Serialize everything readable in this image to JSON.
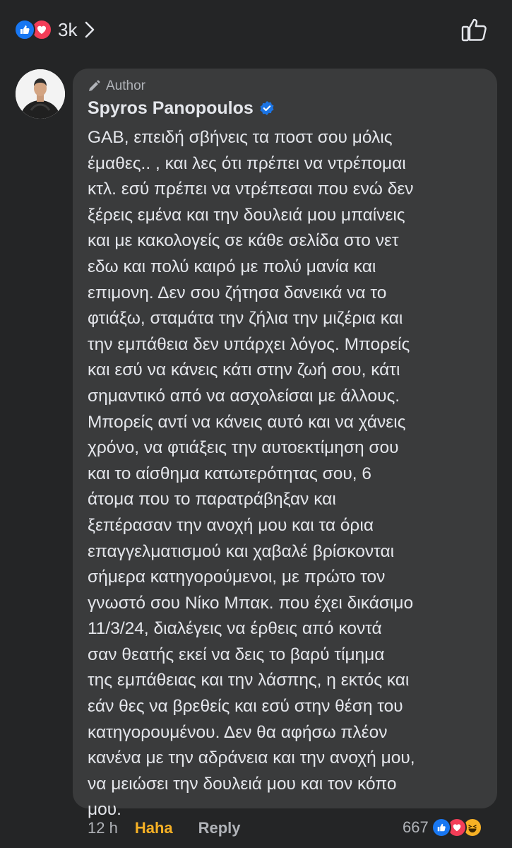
{
  "reactions_bar": {
    "count": "3k",
    "icons": [
      "like-icon",
      "love-icon"
    ],
    "colors": {
      "like": "#1877f2",
      "love": "#f33e58",
      "haha": "#f7b125"
    }
  },
  "comment": {
    "author_label": "Author",
    "name": "Spyros Panopoulos",
    "verified": true,
    "text": "GAB, επειδή σβήνεις τα ποστ σου μόλις\nέμαθες.. , και λες ότι πρέπει να ντρέπομαι\nκτλ. εσύ πρέπει να ντρέπεσαι που ενώ δεν\nξέρεις εμένα και την δουλειά μου μπαίνεις\nκαι με κακολογείς σε κάθε σελίδα στο νετ\nεδω και πολύ καιρό με πολύ μανία και\nεπιμονη. Δεν σου ζήτησα δανεικά να το\nφτιάξω, σταμάτα την ζήλια την μιζέρια και\nτην εμπάθεια δεν υπάρχει λόγος. Μπορείς\nκαι εσύ να κάνεις κάτι στην ζωή σου, κάτι\nσημαντικό από να ασχολείσαι με άλλους.\nΜπορείς αντί να κάνεις αυτό και να χάνεις\nχρόνο, να φτιάξεις την αυτοεκτίμηση σου\nκαι το αίσθημα κατωτερότητας σου, 6\nάτομα που το παρατράβηξαν και\nξεπέρασαν την ανοχή μου και τα όρια\nεπαγγελματισμού και χαβαλέ βρίσκονται\nσήμερα κατηγορούμενοι, με πρώτο τον\nγνωστό σου Νίκο Μπακ. που έχει δικάσιμο\n11/3/24, διαλέγεις να έρθεις από κοντά\nσαν θεατής εκεί να δεις το βαρύ τίμημα\nτης εμπάθειας και την λάσπης, η εκτός και\nεάν θες να βρεθείς και εσύ στην θέση του\nκατηγορουμένου. Δεν θα αφήσω πλέον\nκανένα με την αδράνεια και την ανοχή μου,\nνα μειώσει την δουλειά μου και τον κόπο\nμου.",
    "time": "12 h",
    "haha_label": "Haha",
    "reply_label": "Reply",
    "reaction_count": "667",
    "reaction_icons": [
      "like-icon",
      "love-icon",
      "haha-icon"
    ]
  }
}
